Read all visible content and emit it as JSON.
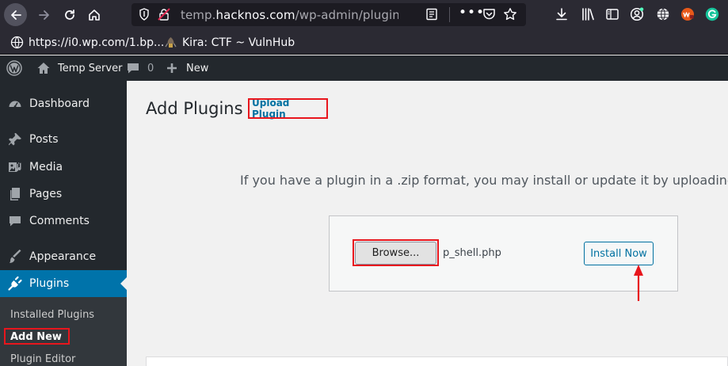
{
  "browser": {
    "url_prefix": "temp.",
    "url_domain": "hacknos.com",
    "url_path": "/wp-admin/plugin-install",
    "menu_dots": "•••"
  },
  "bookmarks": [
    {
      "label": "https://i0.wp.com/1.bp...",
      "icon": "globe-icon"
    },
    {
      "label": "Kira: CTF ~ VulnHub",
      "icon": "vulnhub-icon"
    }
  ],
  "admin_bar": {
    "site_name": "Temp Server",
    "comments_count": "0",
    "new_label": "New"
  },
  "sidebar": {
    "items": [
      {
        "label": "Dashboard",
        "icon": "dashboard-icon"
      },
      {
        "label": "Posts",
        "icon": "pushpin-icon"
      },
      {
        "label": "Media",
        "icon": "media-icon"
      },
      {
        "label": "Pages",
        "icon": "pages-icon"
      },
      {
        "label": "Comments",
        "icon": "comments-icon"
      },
      {
        "label": "Appearance",
        "icon": "paintbrush-icon"
      },
      {
        "label": "Plugins",
        "icon": "plugin-icon"
      }
    ],
    "submenu": [
      {
        "label": "Installed Plugins"
      },
      {
        "label": "Add New"
      },
      {
        "label": "Plugin Editor"
      }
    ]
  },
  "main": {
    "title": "Add Plugins",
    "upload_label": "Upload Plugin",
    "help_text": "If you have a plugin in a .zip format, you may install or update it by uploading it",
    "browse_label": "Browse...",
    "file_name": "p_shell.php",
    "install_label": "Install Now"
  },
  "colors": {
    "admin_bar": "#23282d",
    "active_menu": "#0073aa",
    "highlight": "#e8161d",
    "link": "#0071a1"
  }
}
